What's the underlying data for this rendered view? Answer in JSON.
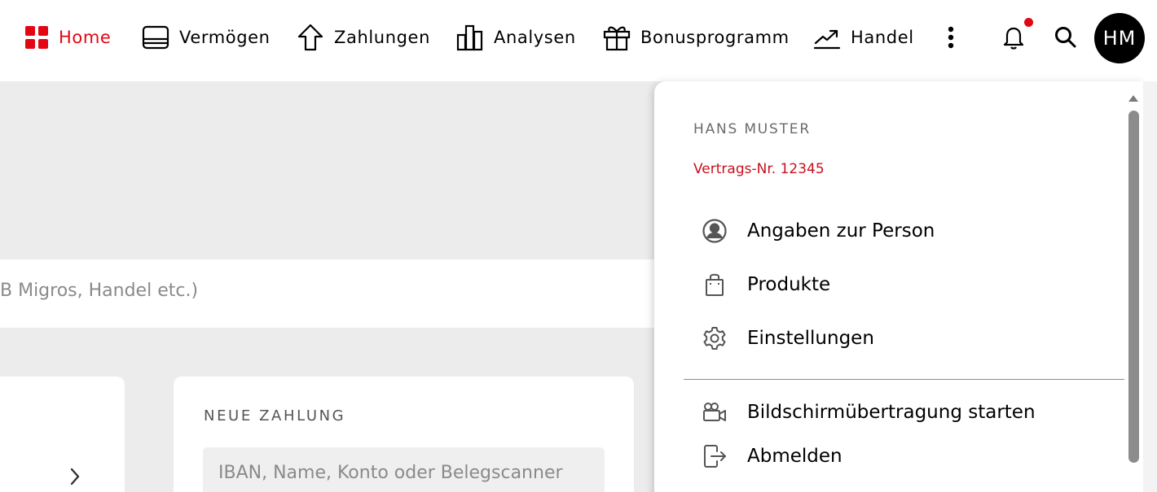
{
  "nav": {
    "home": {
      "label": "Home",
      "icon": "grid-icon"
    },
    "vermoegen": {
      "label": "Vermögen",
      "icon": "wallet-icon"
    },
    "zahlungen": {
      "label": "Zahlungen",
      "icon": "arrow-up-icon"
    },
    "analysen": {
      "label": "Analysen",
      "icon": "bar-chart-icon"
    },
    "bonus": {
      "label": "Bonusprogramm",
      "icon": "gift-icon"
    },
    "handel": {
      "label": "Handel",
      "icon": "trend-up-icon"
    },
    "active_color": "#e30613"
  },
  "header": {
    "avatar_initials": "HM",
    "notification_dot_color": "#e30613"
  },
  "background": {
    "search_hint": "B Migros, Handel etc.)",
    "payment_card": {
      "title": "NEUE ZAHLUNG",
      "input_placeholder": "IBAN, Name, Konto oder Belegscanner"
    }
  },
  "user_menu": {
    "name": "HANS MUSTER",
    "contract": "Vertrags-Nr. 12345",
    "items": [
      {
        "label": "Angaben zur Person",
        "icon": "user-circle-icon"
      },
      {
        "label": "Produkte",
        "icon": "shopping-bag-icon"
      },
      {
        "label": "Einstellungen",
        "icon": "gear-icon"
      },
      {
        "label": "Bildschirmübertragung starten",
        "icon": "video-camera-icon"
      },
      {
        "label": "Abmelden",
        "icon": "logout-icon"
      }
    ]
  }
}
